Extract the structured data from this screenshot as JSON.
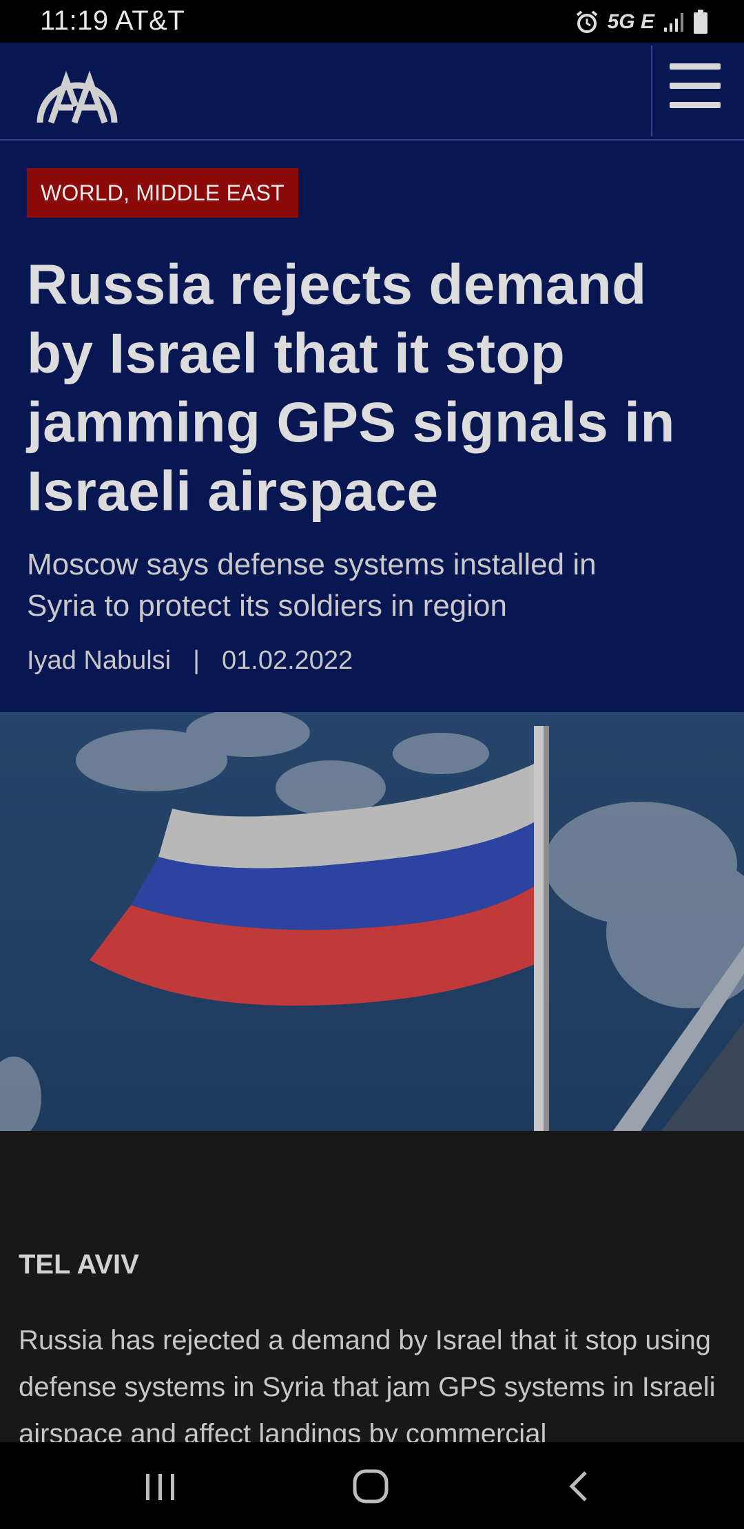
{
  "status_bar": {
    "time_carrier": "11:19 AT&T",
    "network": "5G E",
    "icons": [
      "alarm-icon",
      "signal-icon",
      "battery-icon"
    ]
  },
  "header": {
    "logo_text": "AA",
    "menu_icon": "hamburger-menu-icon"
  },
  "article": {
    "category": "WORLD, MIDDLE EAST",
    "headline": "Russia rejects demand by Israel that it stop jamming GPS signals in Israeli airspace",
    "subheadline": "Moscow says defense systems installed in Syria to protect its soldiers in region",
    "author": "Iyad Nabulsi",
    "separator": "|",
    "date": "01.02.2022",
    "image": "russian-flag-photo",
    "dateline": "TEL AVIV",
    "body": "Russia has rejected a demand by Israel that it stop using defense systems in Syria that jam GPS systems in Israeli airspace and affect landings by commercial"
  },
  "nav_bar": {
    "items": [
      "recent-apps-icon",
      "home-icon",
      "back-icon"
    ]
  },
  "colors": {
    "header_bg": "#081651",
    "category_bg": "#8b0a0a",
    "page_bg": "#181818",
    "text_light": "#dcdcdc"
  }
}
